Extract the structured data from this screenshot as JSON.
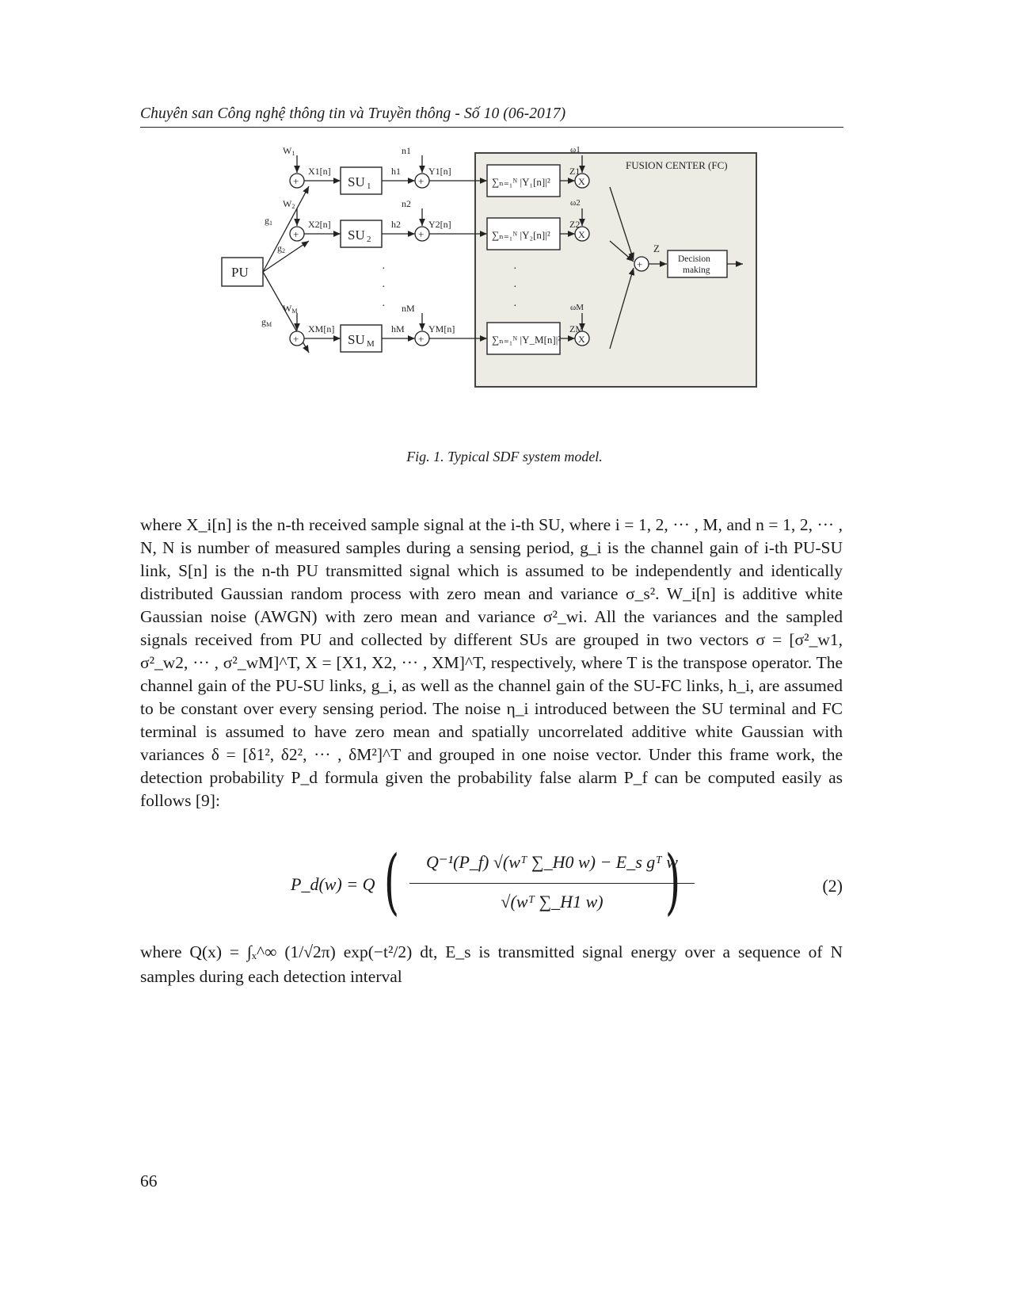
{
  "header": {
    "running_title": "Chuyên san Công nghệ thông tin và Truyền thông - Số 10 (06-2017)"
  },
  "figure": {
    "caption": "Fig. 1. Typical SDF system model.",
    "fc_label": "FUSION CENTER (FC)",
    "pu_label": "PU",
    "decision_label_line1": "Decision",
    "decision_label_line2": "making",
    "z_label": "Z",
    "branches": [
      {
        "g": "g1",
        "w": "W1",
        "x": "X1[n]",
        "su": "SU1",
        "h": "h1",
        "n": "n1",
        "y": "Y1[n]",
        "sum": "∑ₙ₌₁ᴺ |Y₁[n]|²",
        "z": "Z1",
        "omega": "ω1"
      },
      {
        "g": "g2",
        "w": "W2",
        "x": "X2[n]",
        "su": "SU2",
        "h": "h2",
        "n": "n2",
        "y": "Y2[n]",
        "sum": "∑ₙ₌₁ᴺ |Y₂[n]|²",
        "z": "Z2",
        "omega": "ω2"
      },
      {
        "g": "gM",
        "w": "WM",
        "x": "XM[n]",
        "su": "SUM",
        "h": "hM",
        "n": "nM",
        "y": "YM[n]",
        "sum": "∑ₙ₌₁ᴺ |Y_M[n]|²",
        "z": "ZM",
        "omega": "ωM"
      }
    ],
    "ellipsis": "·"
  },
  "body": {
    "paragraph_html_segments": [
      "where X_i[n] is the n-th received sample signal at the i-th SU, where i = 1, 2, ··· , M, and n = 1, 2, ··· , N, N is number of measured samples during a sensing period, g_i is the channel gain of i-th PU-SU link, S[n] is the n-th PU transmitted signal which is assumed to be independently and identically distributed Gaussian random process with zero mean and variance σ_s². W_i[n] is additive white Gaussian noise (AWGN) with zero mean and variance σ²_wi. All the variances and the sampled signals received from PU and collected by different SUs are grouped in two vectors σ = [σ²_w1, σ²_w2, ··· , σ²_wM]^T, X = [X1, X2, ··· , XM]^T, respectively, where T is the transpose operator. The channel gain of the PU-SU links, g_i, as well as the channel gain of the SU-FC links, h_i, are assumed to be constant over every sensing period. The noise η_i introduced between the SU terminal and FC terminal is assumed to have zero mean and spatially uncorrelated additive white Gaussian with variances δ = [δ1², δ2², ··· , δM²]^T and grouped in one noise vector. Under this frame work, the detection probability P_d formula given the probability false alarm P_f can be computed easily as follows [9]:"
    ]
  },
  "equation": {
    "lhs": "P_d(w) = Q",
    "numerator": "Q⁻¹(P_f) √(wᵀ ∑_H0 w) − E_s gᵀ w",
    "denominator": "√(wᵀ ∑_H1 w)",
    "label": "(2)"
  },
  "tail": {
    "text": "where Q(x) = ∫ₓ^∞ (1/√2π) exp(−t²/2) dt, E_s is transmitted signal energy over a sequence of N samples during each detection interval"
  },
  "page_number": "66"
}
